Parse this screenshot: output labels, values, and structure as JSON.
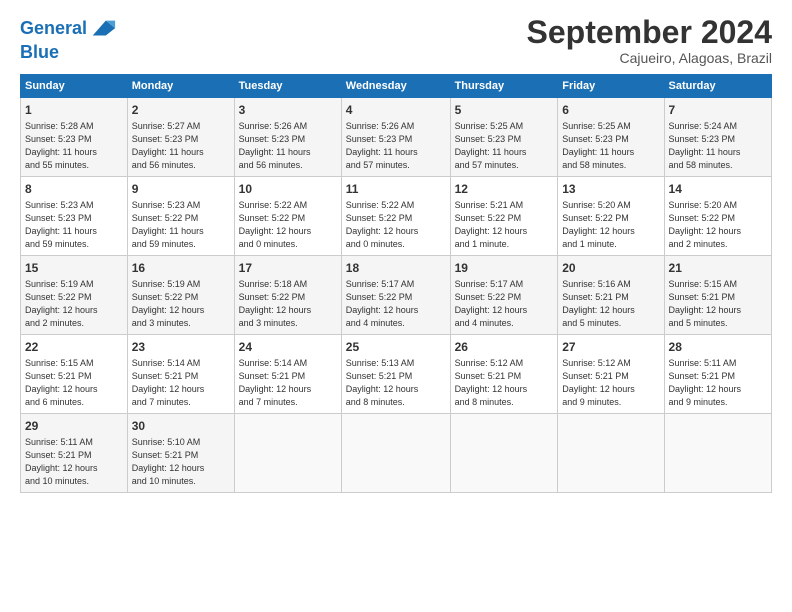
{
  "header": {
    "logo_line1": "General",
    "logo_line2": "Blue",
    "month_title": "September 2024",
    "subtitle": "Cajueiro, Alagoas, Brazil"
  },
  "weekdays": [
    "Sunday",
    "Monday",
    "Tuesday",
    "Wednesday",
    "Thursday",
    "Friday",
    "Saturday"
  ],
  "weeks": [
    [
      {
        "day": "1",
        "info": "Sunrise: 5:28 AM\nSunset: 5:23 PM\nDaylight: 11 hours\nand 55 minutes."
      },
      {
        "day": "2",
        "info": "Sunrise: 5:27 AM\nSunset: 5:23 PM\nDaylight: 11 hours\nand 56 minutes."
      },
      {
        "day": "3",
        "info": "Sunrise: 5:26 AM\nSunset: 5:23 PM\nDaylight: 11 hours\nand 56 minutes."
      },
      {
        "day": "4",
        "info": "Sunrise: 5:26 AM\nSunset: 5:23 PM\nDaylight: 11 hours\nand 57 minutes."
      },
      {
        "day": "5",
        "info": "Sunrise: 5:25 AM\nSunset: 5:23 PM\nDaylight: 11 hours\nand 57 minutes."
      },
      {
        "day": "6",
        "info": "Sunrise: 5:25 AM\nSunset: 5:23 PM\nDaylight: 11 hours\nand 58 minutes."
      },
      {
        "day": "7",
        "info": "Sunrise: 5:24 AM\nSunset: 5:23 PM\nDaylight: 11 hours\nand 58 minutes."
      }
    ],
    [
      {
        "day": "8",
        "info": "Sunrise: 5:23 AM\nSunset: 5:23 PM\nDaylight: 11 hours\nand 59 minutes."
      },
      {
        "day": "9",
        "info": "Sunrise: 5:23 AM\nSunset: 5:22 PM\nDaylight: 11 hours\nand 59 minutes."
      },
      {
        "day": "10",
        "info": "Sunrise: 5:22 AM\nSunset: 5:22 PM\nDaylight: 12 hours\nand 0 minutes."
      },
      {
        "day": "11",
        "info": "Sunrise: 5:22 AM\nSunset: 5:22 PM\nDaylight: 12 hours\nand 0 minutes."
      },
      {
        "day": "12",
        "info": "Sunrise: 5:21 AM\nSunset: 5:22 PM\nDaylight: 12 hours\nand 1 minute."
      },
      {
        "day": "13",
        "info": "Sunrise: 5:20 AM\nSunset: 5:22 PM\nDaylight: 12 hours\nand 1 minute."
      },
      {
        "day": "14",
        "info": "Sunrise: 5:20 AM\nSunset: 5:22 PM\nDaylight: 12 hours\nand 2 minutes."
      }
    ],
    [
      {
        "day": "15",
        "info": "Sunrise: 5:19 AM\nSunset: 5:22 PM\nDaylight: 12 hours\nand 2 minutes."
      },
      {
        "day": "16",
        "info": "Sunrise: 5:19 AM\nSunset: 5:22 PM\nDaylight: 12 hours\nand 3 minutes."
      },
      {
        "day": "17",
        "info": "Sunrise: 5:18 AM\nSunset: 5:22 PM\nDaylight: 12 hours\nand 3 minutes."
      },
      {
        "day": "18",
        "info": "Sunrise: 5:17 AM\nSunset: 5:22 PM\nDaylight: 12 hours\nand 4 minutes."
      },
      {
        "day": "19",
        "info": "Sunrise: 5:17 AM\nSunset: 5:22 PM\nDaylight: 12 hours\nand 4 minutes."
      },
      {
        "day": "20",
        "info": "Sunrise: 5:16 AM\nSunset: 5:21 PM\nDaylight: 12 hours\nand 5 minutes."
      },
      {
        "day": "21",
        "info": "Sunrise: 5:15 AM\nSunset: 5:21 PM\nDaylight: 12 hours\nand 5 minutes."
      }
    ],
    [
      {
        "day": "22",
        "info": "Sunrise: 5:15 AM\nSunset: 5:21 PM\nDaylight: 12 hours\nand 6 minutes."
      },
      {
        "day": "23",
        "info": "Sunrise: 5:14 AM\nSunset: 5:21 PM\nDaylight: 12 hours\nand 7 minutes."
      },
      {
        "day": "24",
        "info": "Sunrise: 5:14 AM\nSunset: 5:21 PM\nDaylight: 12 hours\nand 7 minutes."
      },
      {
        "day": "25",
        "info": "Sunrise: 5:13 AM\nSunset: 5:21 PM\nDaylight: 12 hours\nand 8 minutes."
      },
      {
        "day": "26",
        "info": "Sunrise: 5:12 AM\nSunset: 5:21 PM\nDaylight: 12 hours\nand 8 minutes."
      },
      {
        "day": "27",
        "info": "Sunrise: 5:12 AM\nSunset: 5:21 PM\nDaylight: 12 hours\nand 9 minutes."
      },
      {
        "day": "28",
        "info": "Sunrise: 5:11 AM\nSunset: 5:21 PM\nDaylight: 12 hours\nand 9 minutes."
      }
    ],
    [
      {
        "day": "29",
        "info": "Sunrise: 5:11 AM\nSunset: 5:21 PM\nDaylight: 12 hours\nand 10 minutes."
      },
      {
        "day": "30",
        "info": "Sunrise: 5:10 AM\nSunset: 5:21 PM\nDaylight: 12 hours\nand 10 minutes."
      },
      {
        "day": "",
        "info": ""
      },
      {
        "day": "",
        "info": ""
      },
      {
        "day": "",
        "info": ""
      },
      {
        "day": "",
        "info": ""
      },
      {
        "day": "",
        "info": ""
      }
    ]
  ]
}
